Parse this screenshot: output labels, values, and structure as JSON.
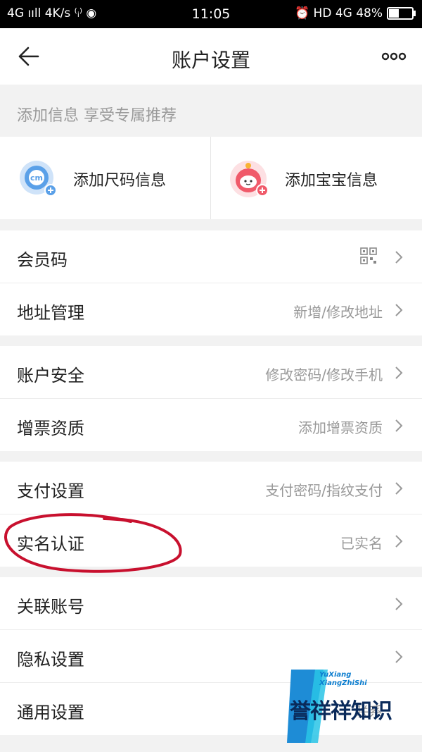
{
  "status_bar": {
    "left": "4G ııll  4K/s ⁽ᵢ⁾ ◉",
    "time": "11:05",
    "right": "⏰ HD 4G 48%",
    "battery_level": 0.48
  },
  "nav": {
    "title": "账户设置"
  },
  "banner": {
    "text": "添加信息 享受专属推荐"
  },
  "add_info": {
    "size_label": "添加尺码信息",
    "baby_label": "添加宝宝信息"
  },
  "groups": [
    {
      "rows": [
        {
          "label": "会员码",
          "value": "",
          "has_qr": true
        },
        {
          "label": "地址管理",
          "value": "新增/修改地址"
        }
      ]
    },
    {
      "rows": [
        {
          "label": "账户安全",
          "value": "修改密码/修改手机"
        },
        {
          "label": "增票资质",
          "value": "添加增票资质"
        }
      ]
    },
    {
      "rows": [
        {
          "label": "支付设置",
          "value": "支付密码/指纹支付"
        },
        {
          "label": "实名认证",
          "value": "已实名"
        }
      ]
    },
    {
      "rows": [
        {
          "label": "关联账号",
          "value": ""
        },
        {
          "label": "隐私设置",
          "value": ""
        },
        {
          "label": "通用设置",
          "value": "联系"
        }
      ]
    }
  ],
  "watermark": {
    "latin_line1": "YuXiang",
    "latin_line2": "XiangZhiShi",
    "text": "誉祥祥知识"
  },
  "colors": {
    "annotation_circle": "#c8102e",
    "accent_blue": "#5aa0e8",
    "accent_red": "#f05a6a"
  }
}
